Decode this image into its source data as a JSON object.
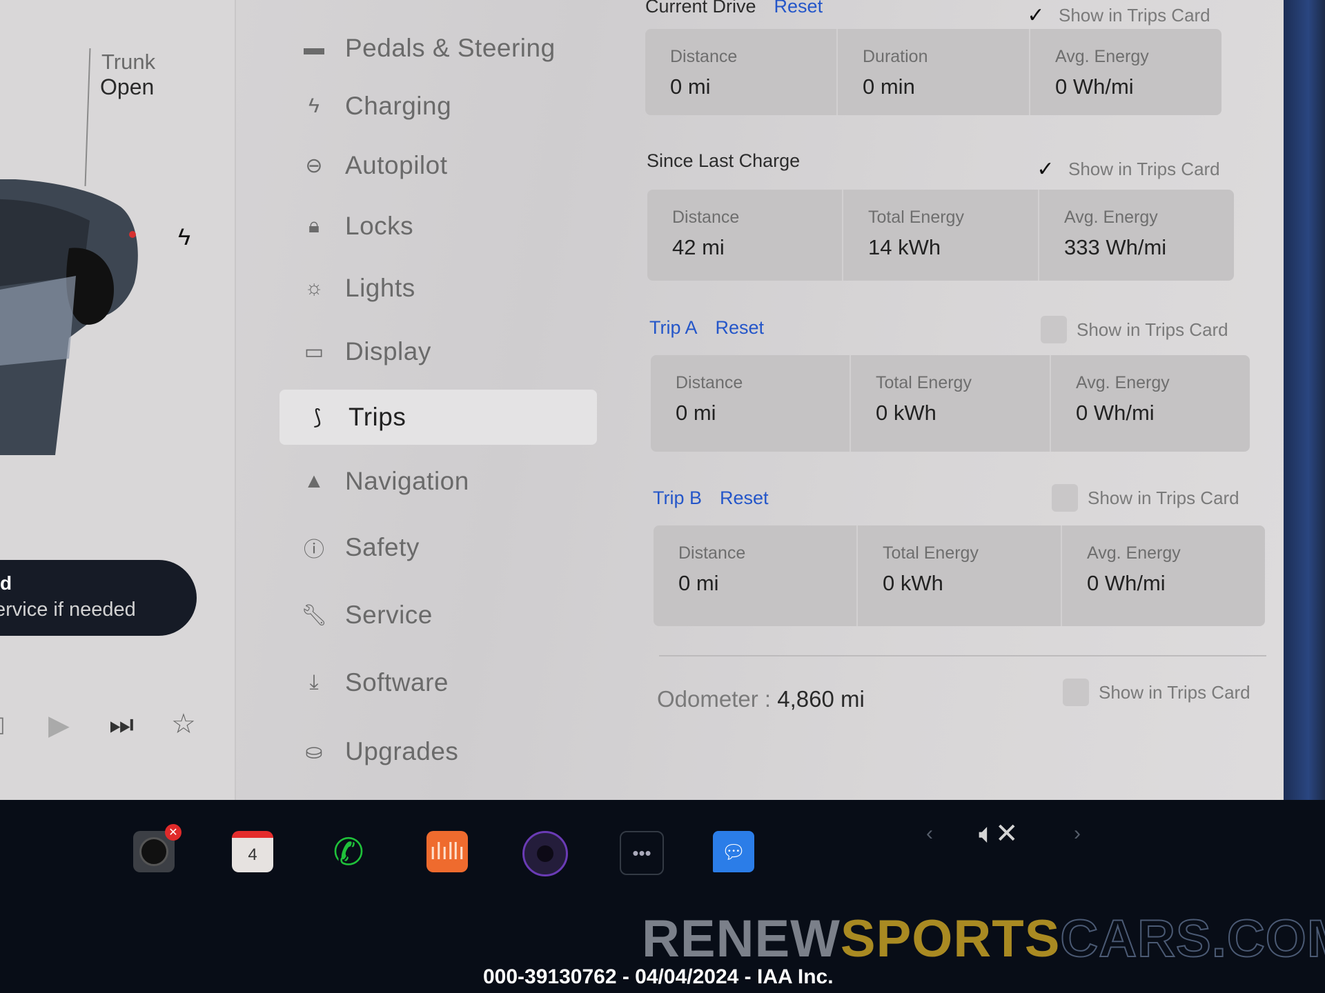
{
  "car_panel": {
    "trunk_label": "Trunk",
    "trunk_value": "Open",
    "charging_icon": "lightning-bolt-icon",
    "alert": {
      "line1": "d",
      "line2": "ervice if needed"
    },
    "media_controls": [
      "previous-icon",
      "play-icon",
      "skip-next-icon",
      "favorite-star-icon"
    ]
  },
  "menu": {
    "items": [
      {
        "label": "Pedals & Steering",
        "icon": "car-icon"
      },
      {
        "label": "Charging",
        "icon": "lightning-icon"
      },
      {
        "label": "Autopilot",
        "icon": "steering-wheel-icon"
      },
      {
        "label": "Locks",
        "icon": "lock-icon"
      },
      {
        "label": "Lights",
        "icon": "sun-icon"
      },
      {
        "label": "Display",
        "icon": "display-icon"
      },
      {
        "label": "Trips",
        "icon": "trips-route-icon",
        "active": true
      },
      {
        "label": "Navigation",
        "icon": "navigation-arrow-icon"
      },
      {
        "label": "Safety",
        "icon": "alert-circle-icon"
      },
      {
        "label": "Service",
        "icon": "wrench-icon"
      },
      {
        "label": "Software",
        "icon": "download-icon"
      },
      {
        "label": "Upgrades",
        "icon": "shopping-bag-icon"
      }
    ]
  },
  "trips": {
    "show_label": "Show in Trips Card",
    "current_drive": {
      "title": "Current Drive",
      "reset": "Reset",
      "show_in_card": true,
      "stats": [
        {
          "label": "Distance",
          "value": "0 mi"
        },
        {
          "label": "Duration",
          "value": "0 min"
        },
        {
          "label": "Avg. Energy",
          "value": "0 Wh/mi"
        }
      ]
    },
    "since_last_charge": {
      "title": "Since Last Charge",
      "show_in_card": true,
      "stats": [
        {
          "label": "Distance",
          "value": "42 mi"
        },
        {
          "label": "Total Energy",
          "value": "14 kWh"
        },
        {
          "label": "Avg. Energy",
          "value": "333 Wh/mi"
        }
      ]
    },
    "trip_a": {
      "title": "Trip A",
      "reset": "Reset",
      "show_in_card": false,
      "stats": [
        {
          "label": "Distance",
          "value": "0 mi"
        },
        {
          "label": "Total Energy",
          "value": "0 kWh"
        },
        {
          "label": "Avg. Energy",
          "value": "0 Wh/mi"
        }
      ]
    },
    "trip_b": {
      "title": "Trip B",
      "reset": "Reset",
      "show_in_card": false,
      "stats": [
        {
          "label": "Distance",
          "value": "0 mi"
        },
        {
          "label": "Total Energy",
          "value": "0 kWh"
        },
        {
          "label": "Avg. Energy",
          "value": "0 Wh/mi"
        }
      ]
    },
    "odometer": {
      "label": "Odometer :",
      "value": "4,860 mi",
      "show_in_card": false
    }
  },
  "dock": {
    "calendar_day": "4",
    "icons": [
      "camera-icon",
      "calendar-icon",
      "phone-icon",
      "audio-icon",
      "dashcam-icon",
      "more-icon",
      "messages-icon"
    ],
    "volume": "muted",
    "check_mark": "✓"
  },
  "watermark": {
    "part1": "RENEW",
    "part2": "SPORTS",
    "part3": "CARS.COM"
  },
  "caption": "000-39130762 - 04/04/2024 - IAA Inc."
}
